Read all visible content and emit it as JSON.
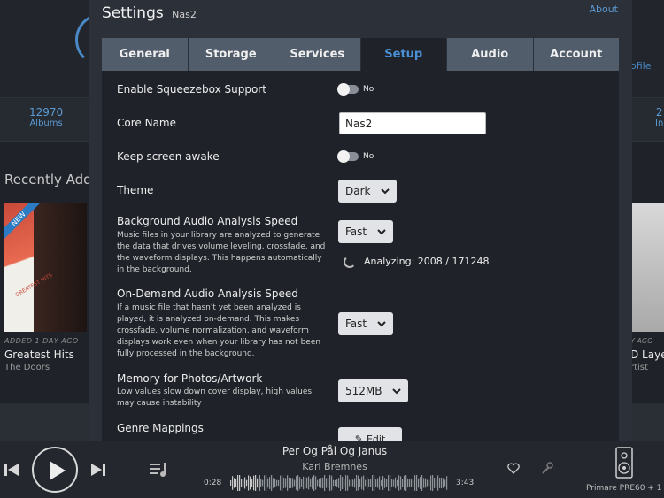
{
  "background": {
    "profile_link": "ofile",
    "stats": [
      {
        "number": "12970",
        "label": "Albums"
      },
      {
        "number": "2",
        "label": "In"
      }
    ],
    "recent_heading": "Recently Adde",
    "albums": [
      {
        "added": "ADDED 1 DAY AGO",
        "title": "Greatest Hits",
        "artist": "The Doors",
        "cover_text": "GREATEST HITS",
        "badge": "NEW"
      },
      {
        "added": "Y AGO",
        "title": "D Laye",
        "artist": "rtist"
      }
    ]
  },
  "dialog": {
    "title": "Settings",
    "subtitle": "Nas2",
    "about_link": "About",
    "tabs": [
      {
        "label": "General",
        "active": false
      },
      {
        "label": "Storage",
        "active": false
      },
      {
        "label": "Services",
        "active": false
      },
      {
        "label": "Setup",
        "active": true
      },
      {
        "label": "Audio",
        "active": false
      },
      {
        "label": "Account",
        "active": false
      }
    ],
    "settings": {
      "squeezebox": {
        "label": "Enable Squeezebox Support",
        "state": "No"
      },
      "core_name": {
        "label": "Core Name",
        "value": "Nas2"
      },
      "keep_awake": {
        "label": "Keep screen awake",
        "state": "No"
      },
      "theme": {
        "label": "Theme",
        "value": "Dark"
      },
      "bg_analysis": {
        "label": "Background Audio Analysis Speed",
        "desc": "Music files in your library are analyzed to generate the data that drives volume leveling, crossfade, and the waveform displays. This happens automatically in the background.",
        "value": "Fast",
        "status": "Analyzing: 2008 / 171248"
      },
      "od_analysis": {
        "label": "On-Demand Audio Analysis Speed",
        "desc": "If a music file that hasn't yet been analyzed is played, it is analyzed on-demand. This makes crossfade, volume normalization, and waveform displays work even when your library has not been fully processed in the background.",
        "value": "Fast"
      },
      "memory": {
        "label": "Memory for Photos/Artwork",
        "desc": "Low values slow down cover display, high values may cause instability",
        "value": "512MB"
      },
      "genre": {
        "label": "Genre Mappings",
        "button": "Edit"
      }
    }
  },
  "player": {
    "track_title": "Per Og Pål Og Janus",
    "artist": "Kari Bremnes",
    "elapsed": "0:28",
    "duration": "3:43",
    "progress": 0.13,
    "zone": "Primare PRE60 + 1"
  },
  "colors": {
    "accent": "#4a90d9",
    "tab_bg": "#515d6b",
    "panel_bg": "#1f2329"
  }
}
